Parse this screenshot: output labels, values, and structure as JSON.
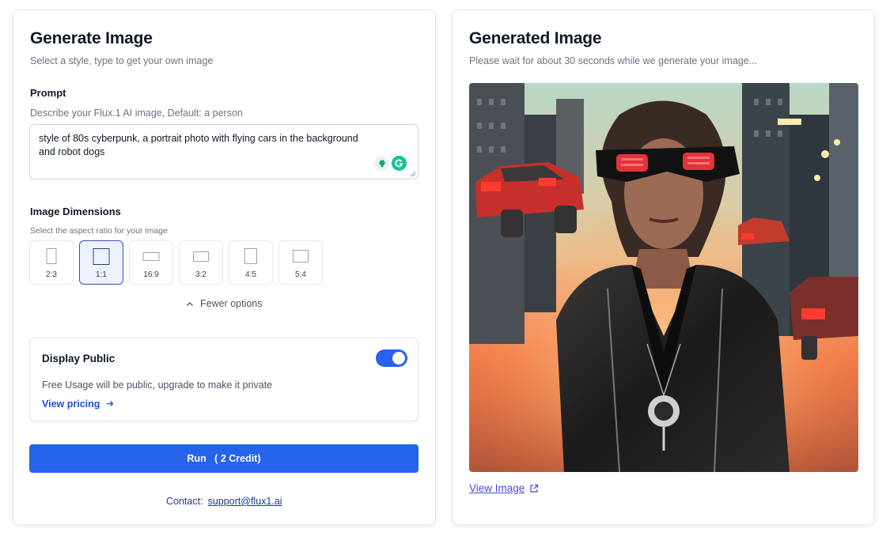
{
  "generate": {
    "title": "Generate Image",
    "subtitle": "Select a style, type to get your own image",
    "prompt_label": "Prompt",
    "prompt_help": "Describe your Flux.1 AI image, Default: a person",
    "prompt_value": "style of 80s cyberpunk, a portrait photo with flying cars in the background and robot dogs",
    "dimensions_label": "Image Dimensions",
    "dimensions_help": "Select the aspect ratio for your image",
    "ratios": [
      "2:3",
      "1:1",
      "16:9",
      "3:2",
      "4:5",
      "5:4"
    ],
    "selected_ratio": "1:1",
    "fewer_options": "Fewer options",
    "public": {
      "title": "Display Public",
      "enabled": true,
      "description": "Free Usage will be public, upgrade to make it private",
      "link": "View pricing"
    },
    "run_label": "Run   ( 2 Credit)",
    "contact_label": "Contact:",
    "contact_email": "support@flux1.ai"
  },
  "generated": {
    "title": "Generated Image",
    "subtitle": "Please wait for about 30 seconds while we generate your image...",
    "view_link": "View Image"
  },
  "colors": {
    "accent": "#2563eb",
    "selected_border": "#3b4cc0",
    "link": "#4f46e5"
  },
  "icons": [
    "bulb-icon",
    "grammarly-icon",
    "chevron-up-icon",
    "arrow-right-icon",
    "external-link-icon"
  ]
}
